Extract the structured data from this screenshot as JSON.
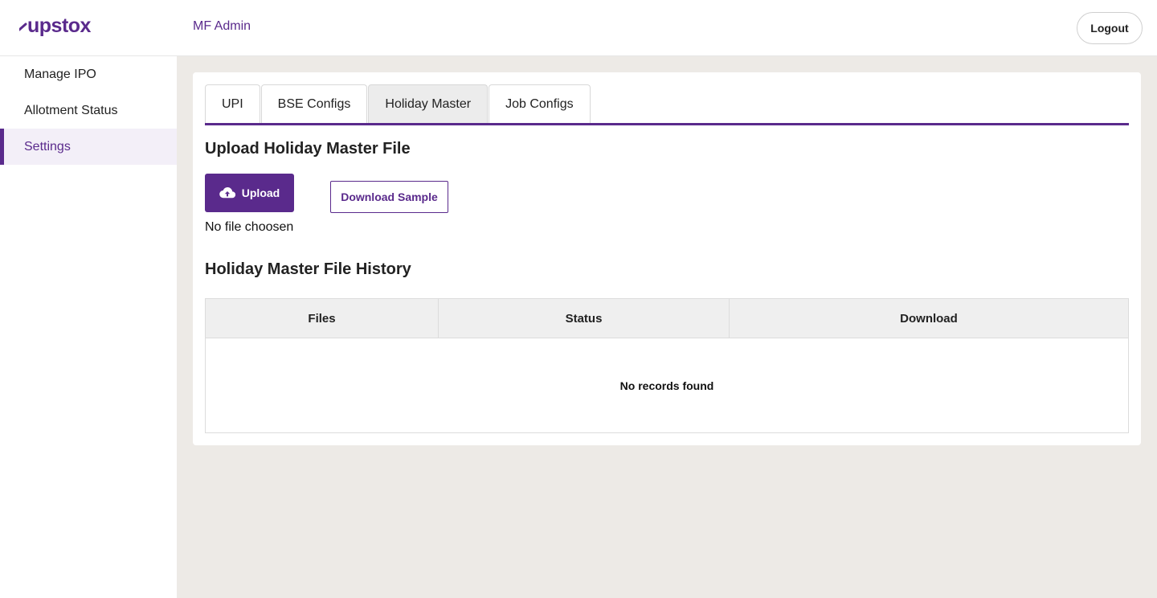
{
  "header": {
    "logo_text": "upstox",
    "app_title": "MF Admin",
    "logout_label": "Logout"
  },
  "sidebar": {
    "items": [
      {
        "label": "Manage IPO",
        "active": false
      },
      {
        "label": "Allotment Status",
        "active": false
      },
      {
        "label": "Settings",
        "active": true
      }
    ]
  },
  "tabs": [
    {
      "label": "UPI",
      "active": false
    },
    {
      "label": "BSE Configs",
      "active": false
    },
    {
      "label": "Holiday Master",
      "active": true
    },
    {
      "label": "Job Configs",
      "active": false
    }
  ],
  "upload_section": {
    "title": "Upload Holiday Master File",
    "upload_label": "Upload",
    "upload_icon": "cloud-upload-icon",
    "download_sample_label": "Download Sample",
    "file_status": "No file choosen"
  },
  "history": {
    "title": "Holiday Master File History",
    "columns": [
      "Files",
      "Status",
      "Download"
    ],
    "empty_message": "No records found"
  },
  "colors": {
    "brand": "#5a2a8c",
    "page_background": "#edeae6",
    "table_header_bg": "#efefef"
  }
}
